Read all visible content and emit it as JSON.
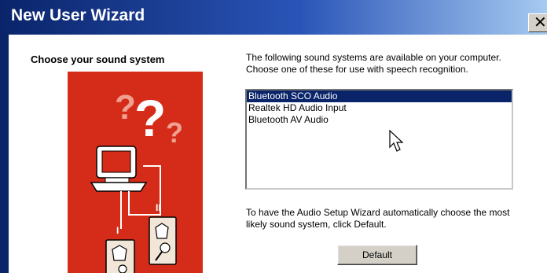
{
  "window": {
    "title": "New User Wizard",
    "close_glyph": "✕"
  },
  "page": {
    "heading": "Choose your sound system",
    "intro": "The following sound systems are available on your computer. Choose one of these for use with speech recognition.",
    "default_note": "To have the Audio Setup Wizard automatically choose the most likely sound system, click Default.",
    "default_button": "Default"
  },
  "listbox": {
    "selected": "Bluetooth SCO Audio",
    "items": [
      "Bluetooth SCO Audio",
      "Realtek HD Audio Input",
      "Bluetooth AV Audio"
    ]
  },
  "art": {
    "icon": "computer-microphones-illustration",
    "background_color": "#d42c19",
    "marks": [
      "?",
      "?",
      "?",
      "I",
      "II"
    ]
  },
  "colors": {
    "title_bar": "#0a246a",
    "selection": "#0a246a",
    "dialog_face": "#d4d0c8"
  }
}
